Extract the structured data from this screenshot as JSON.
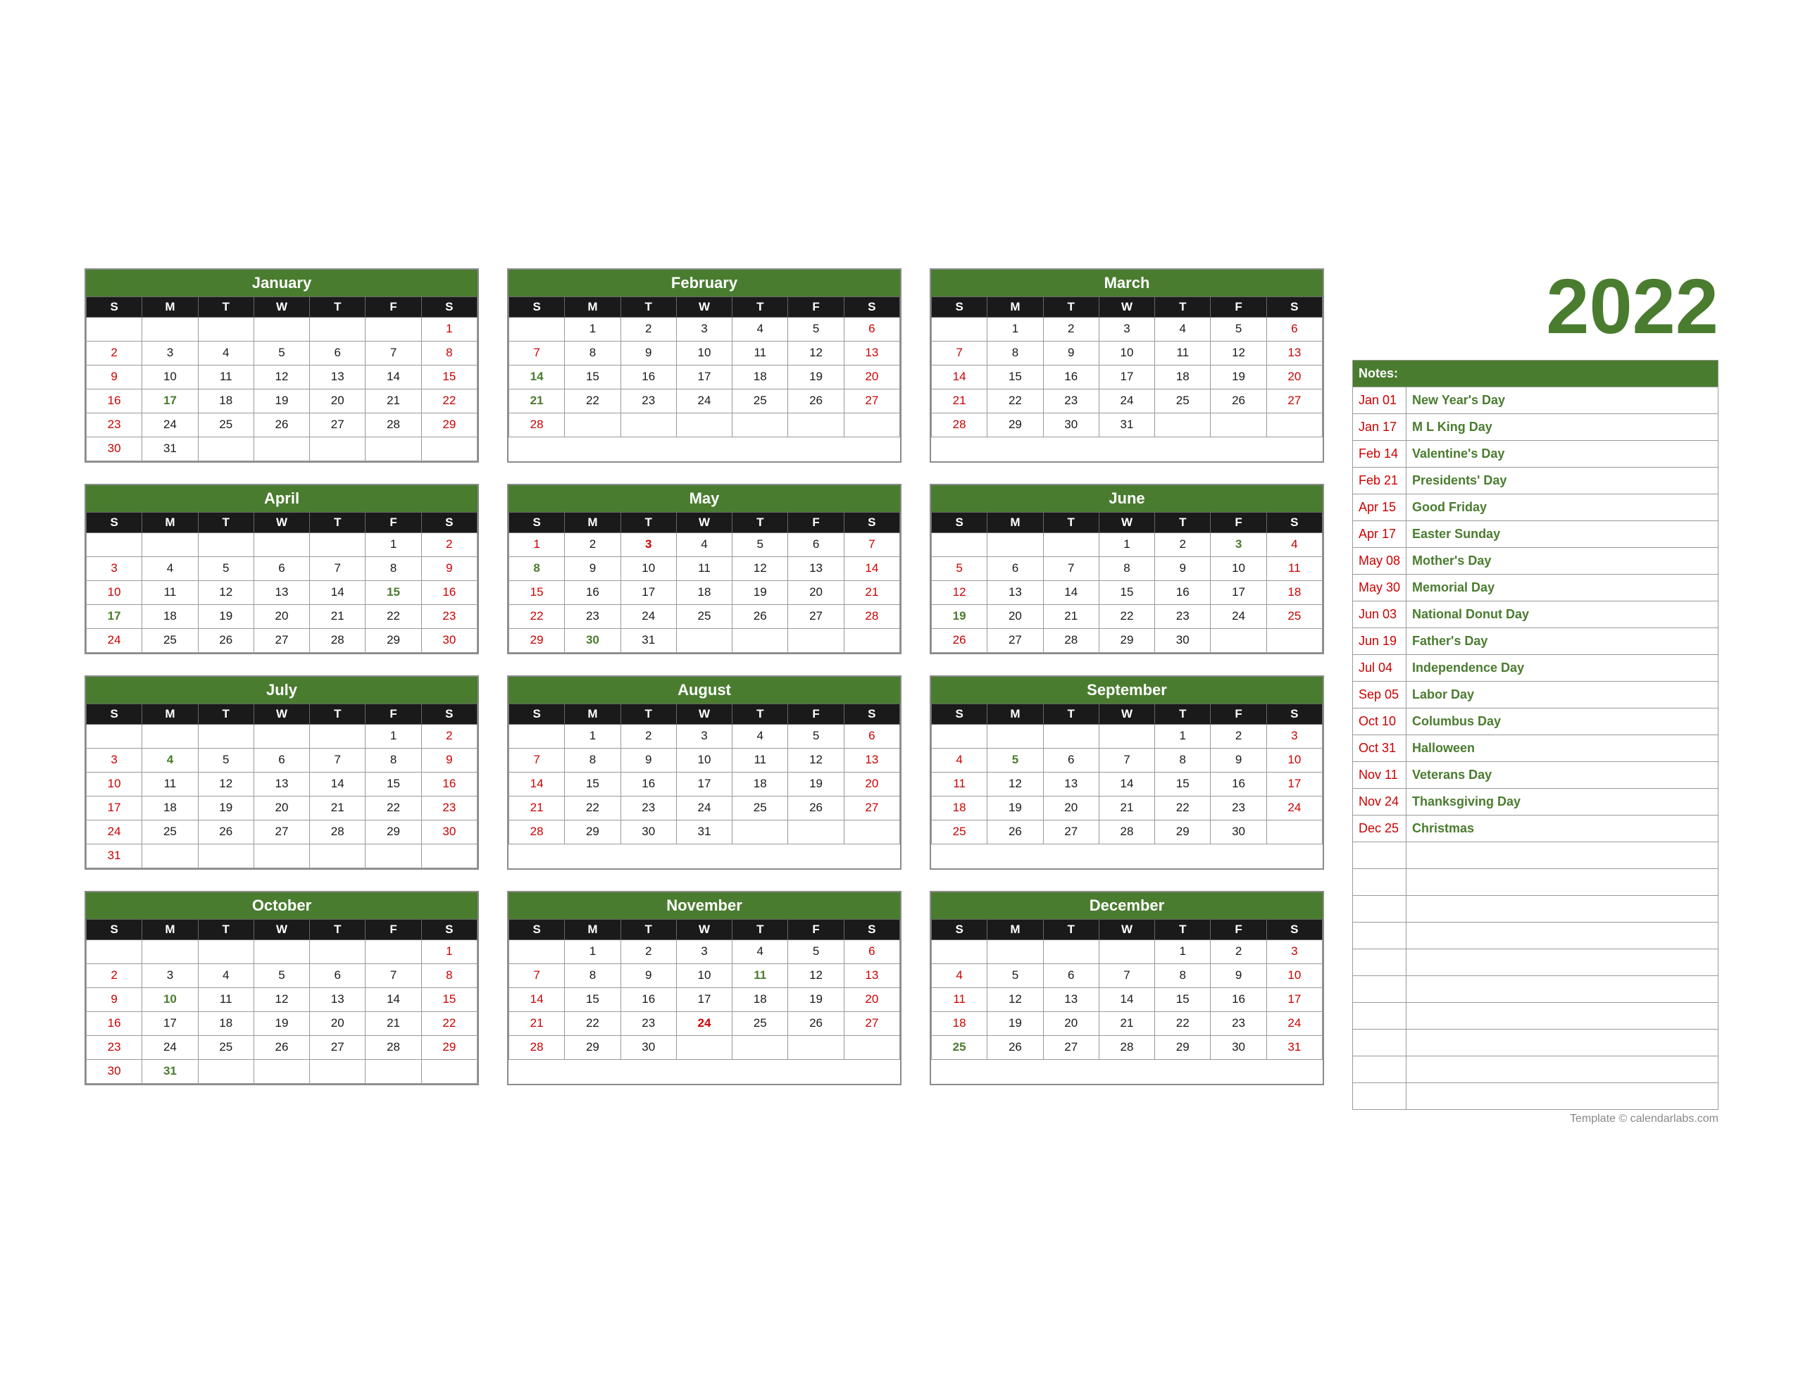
{
  "year": "2022",
  "months": [
    {
      "name": "January",
      "startDay": 6,
      "days": 31,
      "weeks": [
        [
          null,
          null,
          null,
          null,
          null,
          null,
          "1"
        ],
        [
          "2",
          "3",
          "4",
          "5",
          "6",
          "7",
          "8"
        ],
        [
          "9",
          "10",
          "11",
          "12",
          "13",
          "14",
          "15"
        ],
        [
          "16",
          "17",
          "18",
          "19",
          "20",
          "21",
          "22"
        ],
        [
          "23",
          "24",
          "25",
          "26",
          "27",
          "28",
          "29"
        ],
        [
          "30",
          "31",
          null,
          null,
          null,
          null,
          null
        ]
      ],
      "sundays": [
        "2",
        "9",
        "16",
        "23",
        "30"
      ],
      "saturdays": [
        "1",
        "8",
        "15",
        "22",
        "29"
      ],
      "holidays": [
        "17"
      ],
      "specials": []
    },
    {
      "name": "February",
      "startDay": 2,
      "days": 28,
      "weeks": [
        [
          null,
          "1",
          "2",
          "3",
          "4",
          "5",
          "6"
        ],
        [
          "7",
          "8",
          "9",
          "10",
          "11",
          "12",
          "13"
        ],
        [
          "14",
          "15",
          "16",
          "17",
          "18",
          "19",
          "20"
        ],
        [
          "21",
          "22",
          "23",
          "24",
          "25",
          "26",
          "27"
        ],
        [
          "28",
          null,
          null,
          null,
          null,
          null,
          null
        ]
      ],
      "sundays": [
        "6",
        "13",
        "20",
        "27"
      ],
      "saturdays": [
        "5",
        "12",
        "19",
        "26"
      ],
      "holidays": [
        "14",
        "21"
      ],
      "specials": []
    },
    {
      "name": "March",
      "startDay": 2,
      "days": 31,
      "weeks": [
        [
          null,
          "1",
          "2",
          "3",
          "4",
          "5",
          "6"
        ],
        [
          "7",
          "8",
          "9",
          "10",
          "11",
          "12",
          "13"
        ],
        [
          "14",
          "15",
          "16",
          "17",
          "18",
          "19",
          "20"
        ],
        [
          "21",
          "22",
          "23",
          "24",
          "25",
          "26",
          "27"
        ],
        [
          "28",
          "29",
          "30",
          "31",
          null,
          null,
          null
        ]
      ],
      "sundays": [
        "6",
        "13",
        "20",
        "27"
      ],
      "saturdays": [
        "5",
        "12",
        "19",
        "26"
      ],
      "holidays": [],
      "specials": []
    },
    {
      "name": "April",
      "startDay": 5,
      "days": 30,
      "weeks": [
        [
          null,
          null,
          null,
          null,
          null,
          "1",
          "2"
        ],
        [
          "3",
          "4",
          "5",
          "6",
          "7",
          "8",
          "9"
        ],
        [
          "10",
          "11",
          "12",
          "13",
          "14",
          "15",
          "16"
        ],
        [
          "17",
          "18",
          "19",
          "20",
          "21",
          "22",
          "23"
        ],
        [
          "24",
          "25",
          "26",
          "27",
          "28",
          "29",
          "30"
        ]
      ],
      "sundays": [
        "3",
        "10",
        "17",
        "24"
      ],
      "saturdays": [
        "2",
        "9",
        "16",
        "23",
        "30"
      ],
      "holidays": [
        "15",
        "17"
      ],
      "specials": []
    },
    {
      "name": "May",
      "startDay": 0,
      "days": 31,
      "weeks": [
        [
          "1",
          "2",
          "3",
          "4",
          "5",
          "6",
          "7"
        ],
        [
          "8",
          "9",
          "10",
          "11",
          "12",
          "13",
          "14"
        ],
        [
          "15",
          "16",
          "17",
          "18",
          "19",
          "20",
          "21"
        ],
        [
          "22",
          "23",
          "24",
          "25",
          "26",
          "27",
          "28"
        ],
        [
          "29",
          "30",
          "31",
          null,
          null,
          null,
          null
        ]
      ],
      "sundays": [
        "1",
        "8",
        "15",
        "22",
        "29"
      ],
      "saturdays": [
        "7",
        "14",
        "21",
        "28"
      ],
      "holidays": [
        "8",
        "30"
      ],
      "specials": [
        "3"
      ]
    },
    {
      "name": "June",
      "startDay": 3,
      "days": 30,
      "weeks": [
        [
          null,
          null,
          null,
          "1",
          "2",
          "3",
          "4"
        ],
        [
          "5",
          "6",
          "7",
          "8",
          "9",
          "10",
          "11"
        ],
        [
          "12",
          "13",
          "14",
          "15",
          "16",
          "17",
          "18"
        ],
        [
          "19",
          "20",
          "21",
          "22",
          "23",
          "24",
          "25"
        ],
        [
          "26",
          "27",
          "28",
          "29",
          "30",
          null,
          null
        ]
      ],
      "sundays": [
        "5",
        "12",
        "19",
        "26"
      ],
      "saturdays": [
        "4",
        "11",
        "18",
        "25"
      ],
      "holidays": [
        "3",
        "19"
      ],
      "specials": []
    },
    {
      "name": "July",
      "startDay": 5,
      "days": 31,
      "weeks": [
        [
          null,
          null,
          null,
          null,
          null,
          "1",
          "2"
        ],
        [
          "3",
          "4",
          "5",
          "6",
          "7",
          "8",
          "9"
        ],
        [
          "10",
          "11",
          "12",
          "13",
          "14",
          "15",
          "16"
        ],
        [
          "17",
          "18",
          "19",
          "20",
          "21",
          "22",
          "23"
        ],
        [
          "24",
          "25",
          "26",
          "27",
          "28",
          "29",
          "30"
        ],
        [
          "31",
          null,
          null,
          null,
          null,
          null,
          null
        ]
      ],
      "sundays": [
        "3",
        "10",
        "17",
        "24",
        "31"
      ],
      "saturdays": [
        "2",
        "9",
        "16",
        "23",
        "30"
      ],
      "holidays": [
        "4"
      ],
      "specials": []
    },
    {
      "name": "August",
      "startDay": 1,
      "days": 31,
      "weeks": [
        [
          null,
          "1",
          "2",
          "3",
          "4",
          "5",
          "6"
        ],
        [
          "7",
          "8",
          "9",
          "10",
          "11",
          "12",
          "13"
        ],
        [
          "14",
          "15",
          "16",
          "17",
          "18",
          "19",
          "20"
        ],
        [
          "21",
          "22",
          "23",
          "24",
          "25",
          "26",
          "27"
        ],
        [
          "28",
          "29",
          "30",
          "31",
          null,
          null,
          null
        ]
      ],
      "sundays": [
        "7",
        "14",
        "21",
        "28"
      ],
      "saturdays": [
        "6",
        "13",
        "20",
        "27"
      ],
      "holidays": [],
      "specials": []
    },
    {
      "name": "September",
      "startDay": 4,
      "days": 30,
      "weeks": [
        [
          null,
          null,
          null,
          null,
          "1",
          "2",
          "3"
        ],
        [
          "4",
          "5",
          "6",
          "7",
          "8",
          "9",
          "10"
        ],
        [
          "11",
          "12",
          "13",
          "14",
          "15",
          "16",
          "17"
        ],
        [
          "18",
          "19",
          "20",
          "21",
          "22",
          "23",
          "24"
        ],
        [
          "25",
          "26",
          "27",
          "28",
          "29",
          "30",
          null
        ]
      ],
      "sundays": [
        "4",
        "11",
        "18",
        "25"
      ],
      "saturdays": [
        "3",
        "10",
        "17",
        "24"
      ],
      "holidays": [
        "5"
      ],
      "specials": []
    },
    {
      "name": "October",
      "startDay": 6,
      "days": 31,
      "weeks": [
        [
          null,
          null,
          null,
          null,
          null,
          null,
          "1"
        ],
        [
          "2",
          "3",
          "4",
          "5",
          "6",
          "7",
          "8"
        ],
        [
          "9",
          "10",
          "11",
          "12",
          "13",
          "14",
          "15"
        ],
        [
          "16",
          "17",
          "18",
          "19",
          "20",
          "21",
          "22"
        ],
        [
          "23",
          "24",
          "25",
          "26",
          "27",
          "28",
          "29"
        ],
        [
          "30",
          "31",
          null,
          null,
          null,
          null,
          null
        ]
      ],
      "sundays": [
        "2",
        "9",
        "16",
        "23",
        "30"
      ],
      "saturdays": [
        "1",
        "8",
        "15",
        "22",
        "29"
      ],
      "holidays": [
        "10",
        "31"
      ],
      "specials": []
    },
    {
      "name": "November",
      "startDay": 2,
      "days": 30,
      "weeks": [
        [
          null,
          "1",
          "2",
          "3",
          "4",
          "5",
          "6"
        ],
        [
          "7",
          "8",
          "9",
          "10",
          "11",
          "12",
          "13"
        ],
        [
          "14",
          "15",
          "16",
          "17",
          "18",
          "19",
          "20"
        ],
        [
          "21",
          "22",
          "23",
          "24",
          "25",
          "26",
          "27"
        ],
        [
          "28",
          "29",
          "30",
          null,
          null,
          null,
          null
        ]
      ],
      "sundays": [
        "6",
        "13",
        "20",
        "27"
      ],
      "saturdays": [
        "5",
        "12",
        "19",
        "26"
      ],
      "holidays": [
        "11",
        "24"
      ],
      "specials": [
        "24"
      ]
    },
    {
      "name": "December",
      "startDay": 4,
      "days": 31,
      "weeks": [
        [
          null,
          null,
          null,
          null,
          "1",
          "2",
          "3"
        ],
        [
          "4",
          "5",
          "6",
          "7",
          "8",
          "9",
          "10"
        ],
        [
          "11",
          "12",
          "13",
          "14",
          "15",
          "16",
          "17"
        ],
        [
          "18",
          "19",
          "20",
          "21",
          "22",
          "23",
          "24"
        ],
        [
          "25",
          "26",
          "27",
          "28",
          "29",
          "30",
          "31"
        ]
      ],
      "sundays": [
        "4",
        "11",
        "18",
        "25"
      ],
      "saturdays": [
        "3",
        "10",
        "17",
        "24",
        "31"
      ],
      "holidays": [
        "25"
      ],
      "specials": []
    }
  ],
  "notes": {
    "header": "Notes:",
    "holidays": [
      {
        "date": "Jan 01",
        "name": "New Year's Day"
      },
      {
        "date": "Jan 17",
        "name": "M L King Day"
      },
      {
        "date": "Feb 14",
        "name": "Valentine's Day"
      },
      {
        "date": "Feb 21",
        "name": "Presidents' Day"
      },
      {
        "date": "Apr 15",
        "name": "Good Friday"
      },
      {
        "date": "Apr 17",
        "name": "Easter Sunday"
      },
      {
        "date": "May 08",
        "name": "Mother's Day"
      },
      {
        "date": "May 30",
        "name": "Memorial Day"
      },
      {
        "date": "Jun 03",
        "name": "National Donut Day"
      },
      {
        "date": "Jun 19",
        "name": "Father's Day"
      },
      {
        "date": "Jul 04",
        "name": "Independence Day"
      },
      {
        "date": "Sep 05",
        "name": "Labor Day"
      },
      {
        "date": "Oct 10",
        "name": "Columbus Day"
      },
      {
        "date": "Oct 31",
        "name": "Halloween"
      },
      {
        "date": "Nov 11",
        "name": "Veterans Day"
      },
      {
        "date": "Nov 24",
        "name": "Thanksgiving Day"
      },
      {
        "date": "Dec 25",
        "name": "Christmas"
      }
    ],
    "empty_rows": 10
  },
  "footer": "Template © calendarlabs.com",
  "days_header": [
    "S",
    "M",
    "T",
    "W",
    "T",
    "F",
    "S"
  ]
}
